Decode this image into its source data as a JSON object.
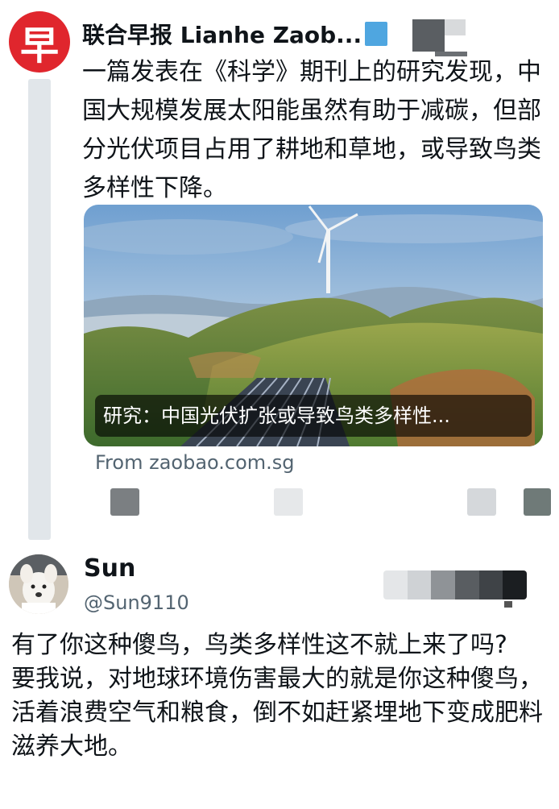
{
  "quoted": {
    "avatar_char": "早",
    "name": "联合早报 Lianhe Zaob...",
    "text": "一篇发表在《科学》期刊上的研究发现，中国大规模发展太阳能虽然有助于减碳，但部分光伏项目占用了耕地和草地，或导致鸟类多样性下降。",
    "card_caption": "研究：中国光伏扩张或导致鸟类多样性...",
    "card_source": "From zaobao.com.sg",
    "colors": {
      "avatar": "#e0262d",
      "verified": "#4fa6e0"
    }
  },
  "reply": {
    "name": "Sun",
    "handle": "@Sun9110",
    "text_line1": "有了你这种傻鸟，鸟类多样性这不就上来了吗?",
    "text_line2": "要我说，对地球环境伤害最大的就是你这种傻鸟，活着浪费空气和粮食，倒不如赶紧埋地下变成肥料滋养大地。"
  }
}
